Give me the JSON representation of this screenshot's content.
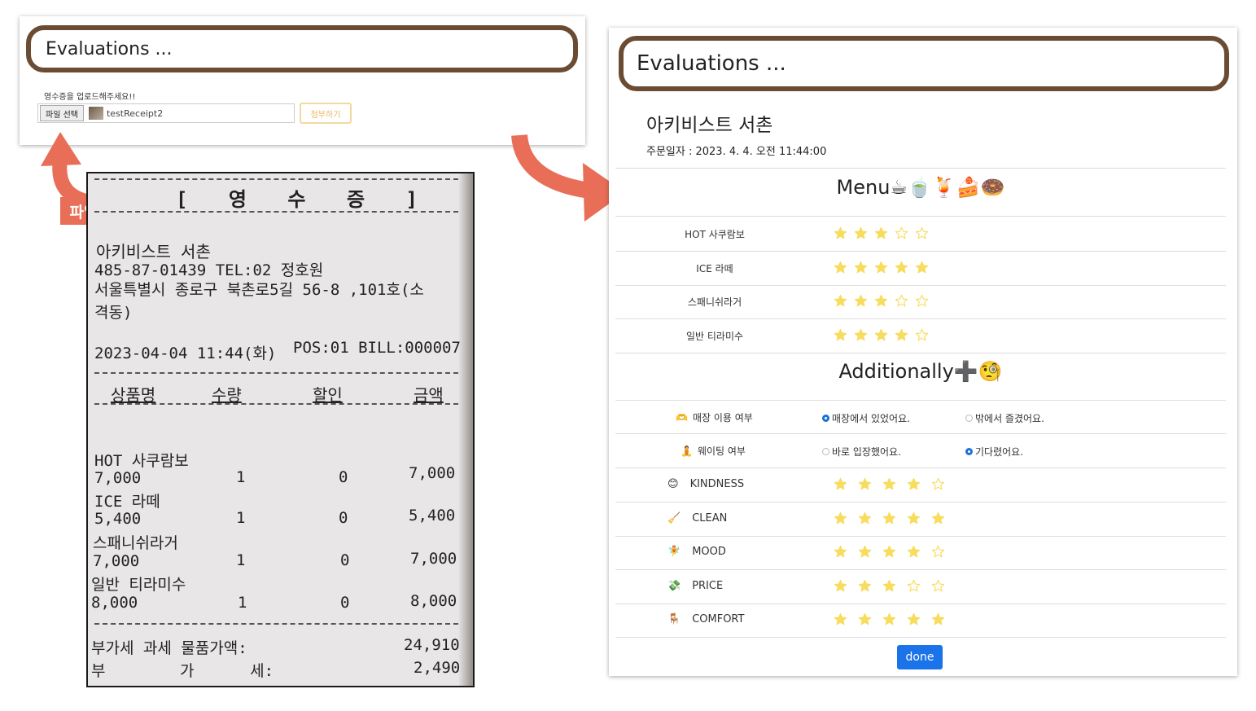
{
  "left_panel": {
    "title": "Evaluations ...",
    "upload_prompt": "영수증을 업로드해주세요!!",
    "choose_file_label": "파일 선택",
    "file_name": "testReceipt2",
    "attach_button": "첨부하기"
  },
  "annotations": {
    "attach_tag": "파일첨부",
    "arrow_color": "#e96e58"
  },
  "receipt": {
    "title": "[ 영 수 증 ]",
    "store": "아키비스트 서촌",
    "business_line": "485-87-01439    TEL:02    정호원",
    "address_1": "서울특별시 종로구 북촌로5길 56-8 ,101호(소",
    "address_2": "격동)",
    "datetime": "2023-04-04 11:44(화)",
    "pos_bill": "POS:01 BILL:000007",
    "headers": [
      "상품명",
      "수량",
      "할인",
      "금액"
    ],
    "items": [
      {
        "name": "HOT 사쿠람보",
        "price": "7,000",
        "qty": "1",
        "discount": "0",
        "amount": "7,000"
      },
      {
        "name": "ICE 라떼",
        "price": "5,400",
        "qty": "1",
        "discount": "0",
        "amount": "5,400"
      },
      {
        "name": "스패니쉬라거",
        "price": "7,000",
        "qty": "1",
        "discount": "0",
        "amount": "7,000"
      },
      {
        "name": "일반 티라미수",
        "price": "8,000",
        "qty": "1",
        "discount": "0",
        "amount": "8,000"
      }
    ],
    "taxable_label": "부가세  과세 물품가액:",
    "taxable_value": "24,910",
    "vat_label": "부        가      세:",
    "vat_value": "2,490"
  },
  "right_panel": {
    "title": "Evaluations ...",
    "restaurant_name": "아키비스트 서촌",
    "order_date": "주문일자 : 2023. 4. 4. 오전 11:44:00",
    "menu_section_title": "Menu☕🍵🍹🍰🍩",
    "menu_items": [
      {
        "label": "HOT 사쿠람보",
        "rating": 3
      },
      {
        "label": "ICE 라떼",
        "rating": 5
      },
      {
        "label": "스패니쉬라거",
        "rating": 3
      },
      {
        "label": "일반 티라미수",
        "rating": 4
      }
    ],
    "additional_section_title": "Additionally➕🧐",
    "dine_in": {
      "icon": "🫶",
      "label": "매장 이용 여부",
      "options": [
        "매장에서 있었어요.",
        "밖에서 즐겼어요."
      ],
      "selected": 0
    },
    "waiting": {
      "icon": "🧘",
      "label": "웨이팅 여부",
      "options": [
        "바로 입장했어요.",
        "기다렸어요."
      ],
      "selected": 1
    },
    "attributes": [
      {
        "icon": "😊",
        "label": "KINDNESS",
        "rating": 4
      },
      {
        "icon": "🧹",
        "label": "CLEAN",
        "rating": 5
      },
      {
        "icon": "🧚",
        "label": "MOOD",
        "rating": 4
      },
      {
        "icon": "💸",
        "label": "PRICE",
        "rating": 3
      },
      {
        "icon": "🪑",
        "label": "COMFORT",
        "rating": 5
      }
    ],
    "done_button": "done",
    "star_color": "#f7dc5e"
  }
}
